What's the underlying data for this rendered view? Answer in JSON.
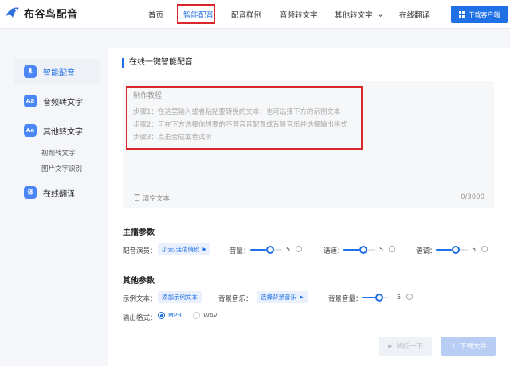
{
  "brand": {
    "name": "布谷鸟配音",
    "accent": "#1f6fe5"
  },
  "nav": {
    "items": [
      {
        "label": "首页"
      },
      {
        "label": "智能配音",
        "active": true
      },
      {
        "label": "配音样例"
      },
      {
        "label": "音频转文字"
      },
      {
        "label": "其他转文字"
      },
      {
        "label": "在线翻译"
      }
    ],
    "download_label": "下载客户端"
  },
  "sidebar": {
    "items": [
      {
        "label": "智能配音",
        "icon": "mic-icon",
        "badge": "",
        "active": true
      },
      {
        "label": "音频转文字",
        "icon": "audio-text-icon",
        "badge": "Aa"
      },
      {
        "label": "其他转文字",
        "icon": "other-text-icon",
        "badge": "Aa"
      },
      {
        "label": "在线翻译",
        "icon": "translate-icon",
        "badge": "译"
      }
    ],
    "subitems": [
      "视频转文字",
      "图片文字识别"
    ]
  },
  "main": {
    "title": "在线一键智能配音",
    "editor": {
      "heading": "制作教程",
      "steps": [
        "步骤1：在这里输入或者粘贴要转换的文本，也可选择下方的示例文本",
        "步骤2：可在下方选择你想要的不同音音配置或背景音乐并选择输出格式",
        "步骤3：点击合成或者试听"
      ],
      "clear_label": "清空文本",
      "counter": "0/3000"
    },
    "anchor_params": {
      "heading": "主播参数",
      "voice_label": "配音演员：",
      "voice_value": "小云/活泼俏皮",
      "sliders": [
        {
          "label": "音量：",
          "value": "5",
          "level": 0.5
        },
        {
          "label": "语速：",
          "value": "5",
          "level": 0.5
        },
        {
          "label": "语调：",
          "value": "5",
          "level": 0.5
        }
      ]
    },
    "other_params": {
      "heading": "其他参数",
      "sample_label": "示例文本：",
      "sample_button": "添加示例文本",
      "bgm_label": "背景音乐：",
      "bgm_button": "选择背景音乐",
      "bgm_volume_label": "背景音量：",
      "bgm_volume_value": "5",
      "bgm_volume_level": 0.5,
      "format_label": "输出格式：",
      "formats": [
        {
          "label": "MP3",
          "selected": true
        },
        {
          "label": "WAV",
          "selected": false
        }
      ]
    },
    "actions": {
      "preview_label": "试听一下",
      "download_label": "下载文件"
    }
  }
}
